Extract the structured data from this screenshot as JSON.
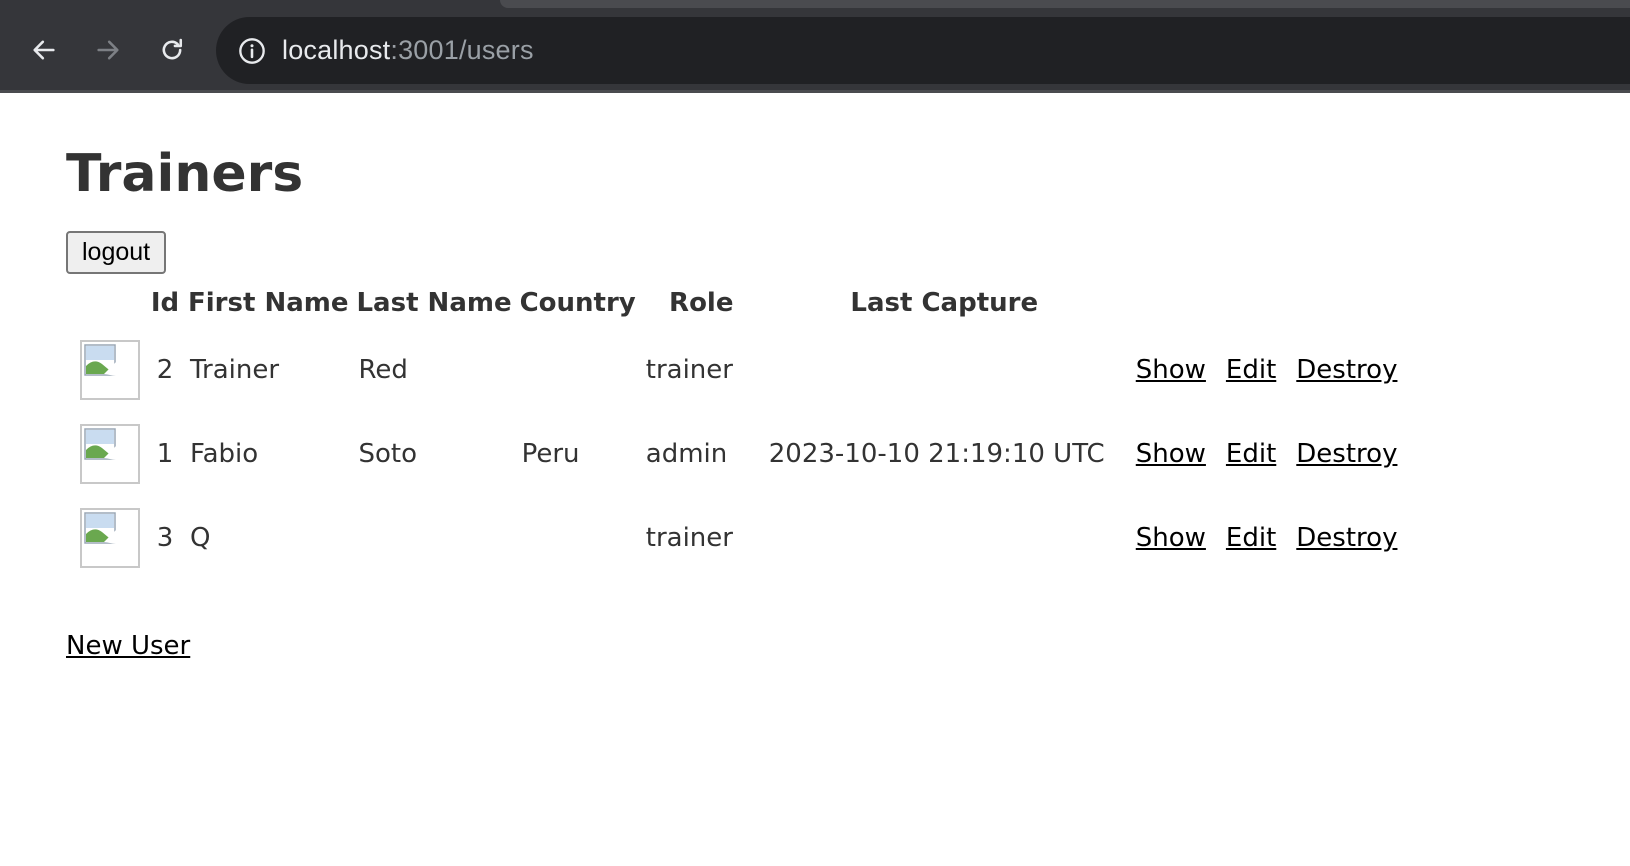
{
  "browser": {
    "url_host": "localhost",
    "url_rest": ":3001/users"
  },
  "page": {
    "title": "Trainers",
    "logout_label": "logout",
    "new_user_label": "New User"
  },
  "table": {
    "headers": {
      "id": "Id",
      "first_name": "First Name",
      "last_name": "Last Name",
      "country": "Country",
      "role": "Role",
      "last_capture": "Last Capture"
    },
    "rows": [
      {
        "id": "2",
        "first_name": "Trainer",
        "last_name": "Red",
        "country": "",
        "role": "trainer",
        "last_capture": "",
        "show": "Show",
        "edit": "Edit",
        "destroy": "Destroy"
      },
      {
        "id": "1",
        "first_name": "Fabio",
        "last_name": "Soto",
        "country": "Peru",
        "role": "admin",
        "last_capture": "2023-10-10 21:19:10 UTC",
        "show": "Show",
        "edit": "Edit",
        "destroy": "Destroy"
      },
      {
        "id": "3",
        "first_name": "Q",
        "last_name": "",
        "country": "",
        "role": "trainer",
        "last_capture": "",
        "show": "Show",
        "edit": "Edit",
        "destroy": "Destroy"
      }
    ]
  },
  "icons": {
    "back": "arrow-left-icon",
    "forward": "arrow-right-icon",
    "reload": "reload-icon",
    "site_info": "info-icon",
    "avatar": "broken-image-icon"
  }
}
